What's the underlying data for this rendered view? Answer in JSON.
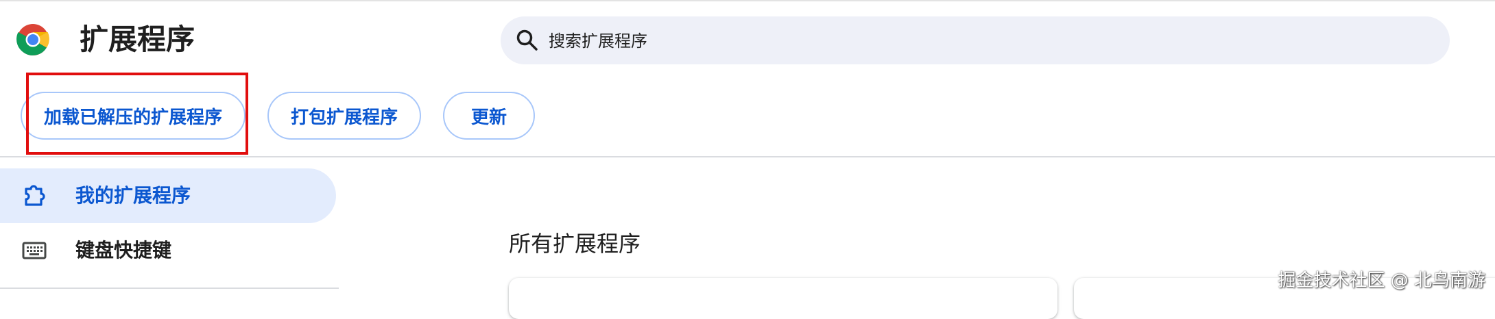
{
  "header": {
    "logo_icon": "chrome-logo-icon",
    "title": "扩展程序",
    "search": {
      "icon": "search-icon",
      "placeholder": "搜索扩展程序",
      "value": ""
    }
  },
  "toolbar": {
    "load_unpacked_label": "加载已解压的扩展程序",
    "pack_label": "打包扩展程序",
    "update_label": "更新",
    "highlight_color": "#e10e0e",
    "accent_color": "#0b57d0"
  },
  "sidebar": {
    "items": [
      {
        "label": "我的扩展程序",
        "icon": "extension-puzzle-icon",
        "active": true
      },
      {
        "label": "键盘快捷键",
        "icon": "keyboard-icon",
        "active": false
      }
    ]
  },
  "main": {
    "section_title": "所有扩展程序"
  },
  "watermark": "掘金技术社区 @ 北鸟南游"
}
